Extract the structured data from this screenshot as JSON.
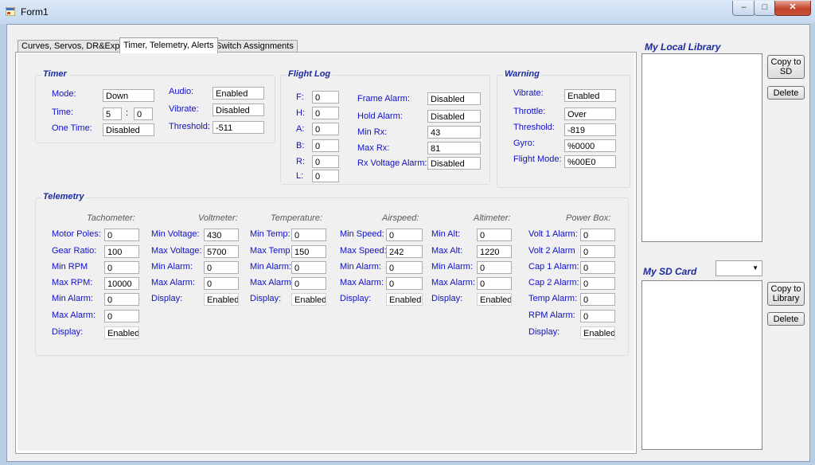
{
  "window": {
    "title": "Form1",
    "min_glyph": "–",
    "max_glyph": "□",
    "close_glyph": "✕"
  },
  "tabs": [
    "Curves, Servos, DR&Expo",
    "Timer, Telemetry, Alerts",
    "Switch Assignments"
  ],
  "timer": {
    "title": "Timer",
    "mode_label": "Mode:",
    "mode_value": "Down",
    "time_label": "Time:",
    "time_min": "5",
    "time_sep": ":",
    "time_sec": "0",
    "onetime_label": "One Time:",
    "onetime_value": "Disabled",
    "audio_label": "Audio:",
    "audio_value": "Enabled",
    "vibrate_label": "Vibrate:",
    "vibrate_value": "Disabled",
    "threshold_label": "Threshold:",
    "threshold_value": "-511"
  },
  "flight_log": {
    "title": "Flight Log",
    "counters": [
      {
        "label": "F:",
        "value": "0"
      },
      {
        "label": "H:",
        "value": "0"
      },
      {
        "label": "A:",
        "value": "0"
      },
      {
        "label": "B:",
        "value": "0"
      },
      {
        "label": "R:",
        "value": "0"
      },
      {
        "label": "L:",
        "value": "0"
      }
    ],
    "fields": [
      {
        "label": "Frame Alarm:",
        "value": "Disabled"
      },
      {
        "label": "Hold Alarm:",
        "value": "Disabled"
      },
      {
        "label": "Min Rx:",
        "value": "43"
      },
      {
        "label": "Max Rx:",
        "value": "81"
      },
      {
        "label": "Rx Voltage Alarm:",
        "value": "Disabled"
      }
    ]
  },
  "warning": {
    "title": "Warning",
    "fields": [
      {
        "label": "Vibrate:",
        "value": "Enabled"
      },
      {
        "label": "Throttle:",
        "value": "Over"
      },
      {
        "label": "Threshold:",
        "value": "-819"
      },
      {
        "label": "Gyro:",
        "value": "%0000"
      },
      {
        "label": "Flight Mode:",
        "value": "%00E0"
      }
    ]
  },
  "telemetry": {
    "title": "Telemetry",
    "tachometer": {
      "header": "Tachometer:",
      "fields": [
        {
          "label": "Motor Poles:",
          "value": "0"
        },
        {
          "label": "Gear Ratio:",
          "value": "100"
        },
        {
          "label": "Min RPM",
          "value": "0"
        },
        {
          "label": "Max RPM:",
          "value": "10000"
        },
        {
          "label": "Min Alarm:",
          "value": "0"
        },
        {
          "label": "Max Alarm:",
          "value": "0"
        },
        {
          "label": "Display:",
          "value": "Enabled"
        }
      ]
    },
    "voltmeter": {
      "header": "Voltmeter:",
      "fields": [
        {
          "label": "Min Voltage:",
          "value": "430"
        },
        {
          "label": "Max Voltage:",
          "value": "5700"
        },
        {
          "label": "Min Alarm:",
          "value": "0"
        },
        {
          "label": "Max Alarm:",
          "value": "0"
        },
        {
          "label": "Display:",
          "value": "Enabled"
        }
      ]
    },
    "temperature": {
      "header": "Temperature:",
      "fields": [
        {
          "label": "Min Temp:",
          "value": "0"
        },
        {
          "label": "Max Temp",
          "value": "150"
        },
        {
          "label": "Min Alarm:",
          "value": "0"
        },
        {
          "label": "Max Alarm:",
          "value": "0"
        },
        {
          "label": "Display:",
          "value": "Enabled"
        }
      ]
    },
    "airspeed": {
      "header": "Airspeed:",
      "fields": [
        {
          "label": "Min Speed:",
          "value": "0"
        },
        {
          "label": "Max Speed:",
          "value": "242"
        },
        {
          "label": "Min Alarm:",
          "value": "0"
        },
        {
          "label": "Max Alarm:",
          "value": "0"
        },
        {
          "label": "Display:",
          "value": "Enabled"
        }
      ]
    },
    "altimeter": {
      "header": "Altimeter:",
      "fields": [
        {
          "label": "Min Alt:",
          "value": "0"
        },
        {
          "label": "Max Alt:",
          "value": "1220"
        },
        {
          "label": "Min Alarm:",
          "value": "0"
        },
        {
          "label": "Max Alarm:",
          "value": "0"
        },
        {
          "label": "Display:",
          "value": "Enabled"
        }
      ]
    },
    "power_box": {
      "header": "Power Box:",
      "fields": [
        {
          "label": "Volt 1 Alarm:",
          "value": "0"
        },
        {
          "label": "Volt 2 Alarm",
          "value": "0"
        },
        {
          "label": "Cap 1 Alarm:",
          "value": "0"
        },
        {
          "label": "Cap 2 Alarm:",
          "value": "0"
        },
        {
          "label": "Temp Alarm:",
          "value": "0"
        },
        {
          "label": "RPM Alarm:",
          "value": "0"
        },
        {
          "label": "Display:",
          "value": "Enabled"
        }
      ]
    }
  },
  "local_library": {
    "title": "My Local Library",
    "copy_button": "Copy to SD",
    "delete_button": "Delete"
  },
  "sd_card": {
    "title": "My SD Card",
    "dropdown_value": "",
    "copy_button": "Copy to Library",
    "delete_button": "Delete"
  }
}
